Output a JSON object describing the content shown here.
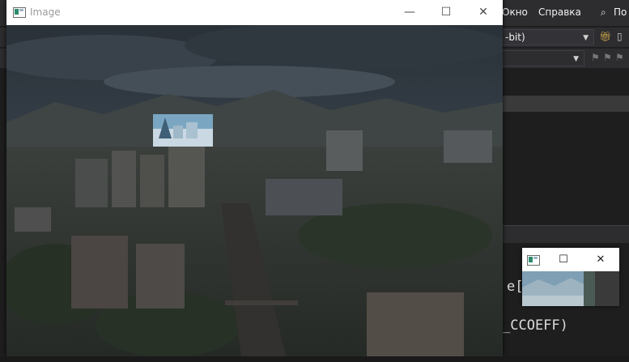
{
  "ide": {
    "menu": {
      "window": "Окно",
      "help": "Справка",
      "search_short": "По"
    },
    "platform_combo": "-bit)",
    "code": {
      "line1": "e[:",
      "line2": "_CCOEFF)"
    }
  },
  "image_window": {
    "title": "Image",
    "controls": {
      "minimize": "—",
      "maximize": "☐",
      "close": "✕"
    }
  },
  "preview_window": {
    "controls": {
      "maximize": "☐",
      "close": "✕"
    }
  }
}
